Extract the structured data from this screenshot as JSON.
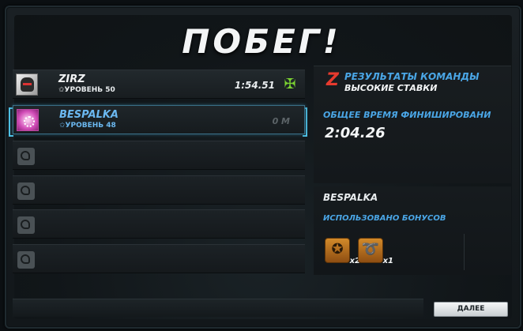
{
  "title": "ПОБЕГ!",
  "players": [
    {
      "name": "ZIRZ",
      "level": "✩УРОВЕНЬ 50",
      "time": "1:54.51"
    },
    {
      "name": "BESPALKA",
      "level": "✩УРОВЕНЬ 48",
      "distance": "0 M"
    }
  ],
  "empty_slots": 4,
  "team": {
    "title": "РЕЗУЛЬТАТЫ КОМАНДЫ",
    "subtitle": "ВЫСОКИЕ СТАВКИ",
    "finish_label": "ОБЩЕЕ ВРЕМЯ ФИНИШИРОВАНИ",
    "finish_time": "2:04.26"
  },
  "bonuses": {
    "player": "BESPALKA",
    "label": "ИСПОЛЬЗОВАНО БОНУСОВ",
    "items": [
      {
        "icon": "star-wheel-icon",
        "count": "x2"
      },
      {
        "icon": "nitro-swirl-icon",
        "count": "x1"
      }
    ]
  },
  "next_button": "ДАЛЕЕ",
  "colors": {
    "accent": "#4aa6e6",
    "finish_green": "#7bd231",
    "team_red": "#e63a2e"
  }
}
